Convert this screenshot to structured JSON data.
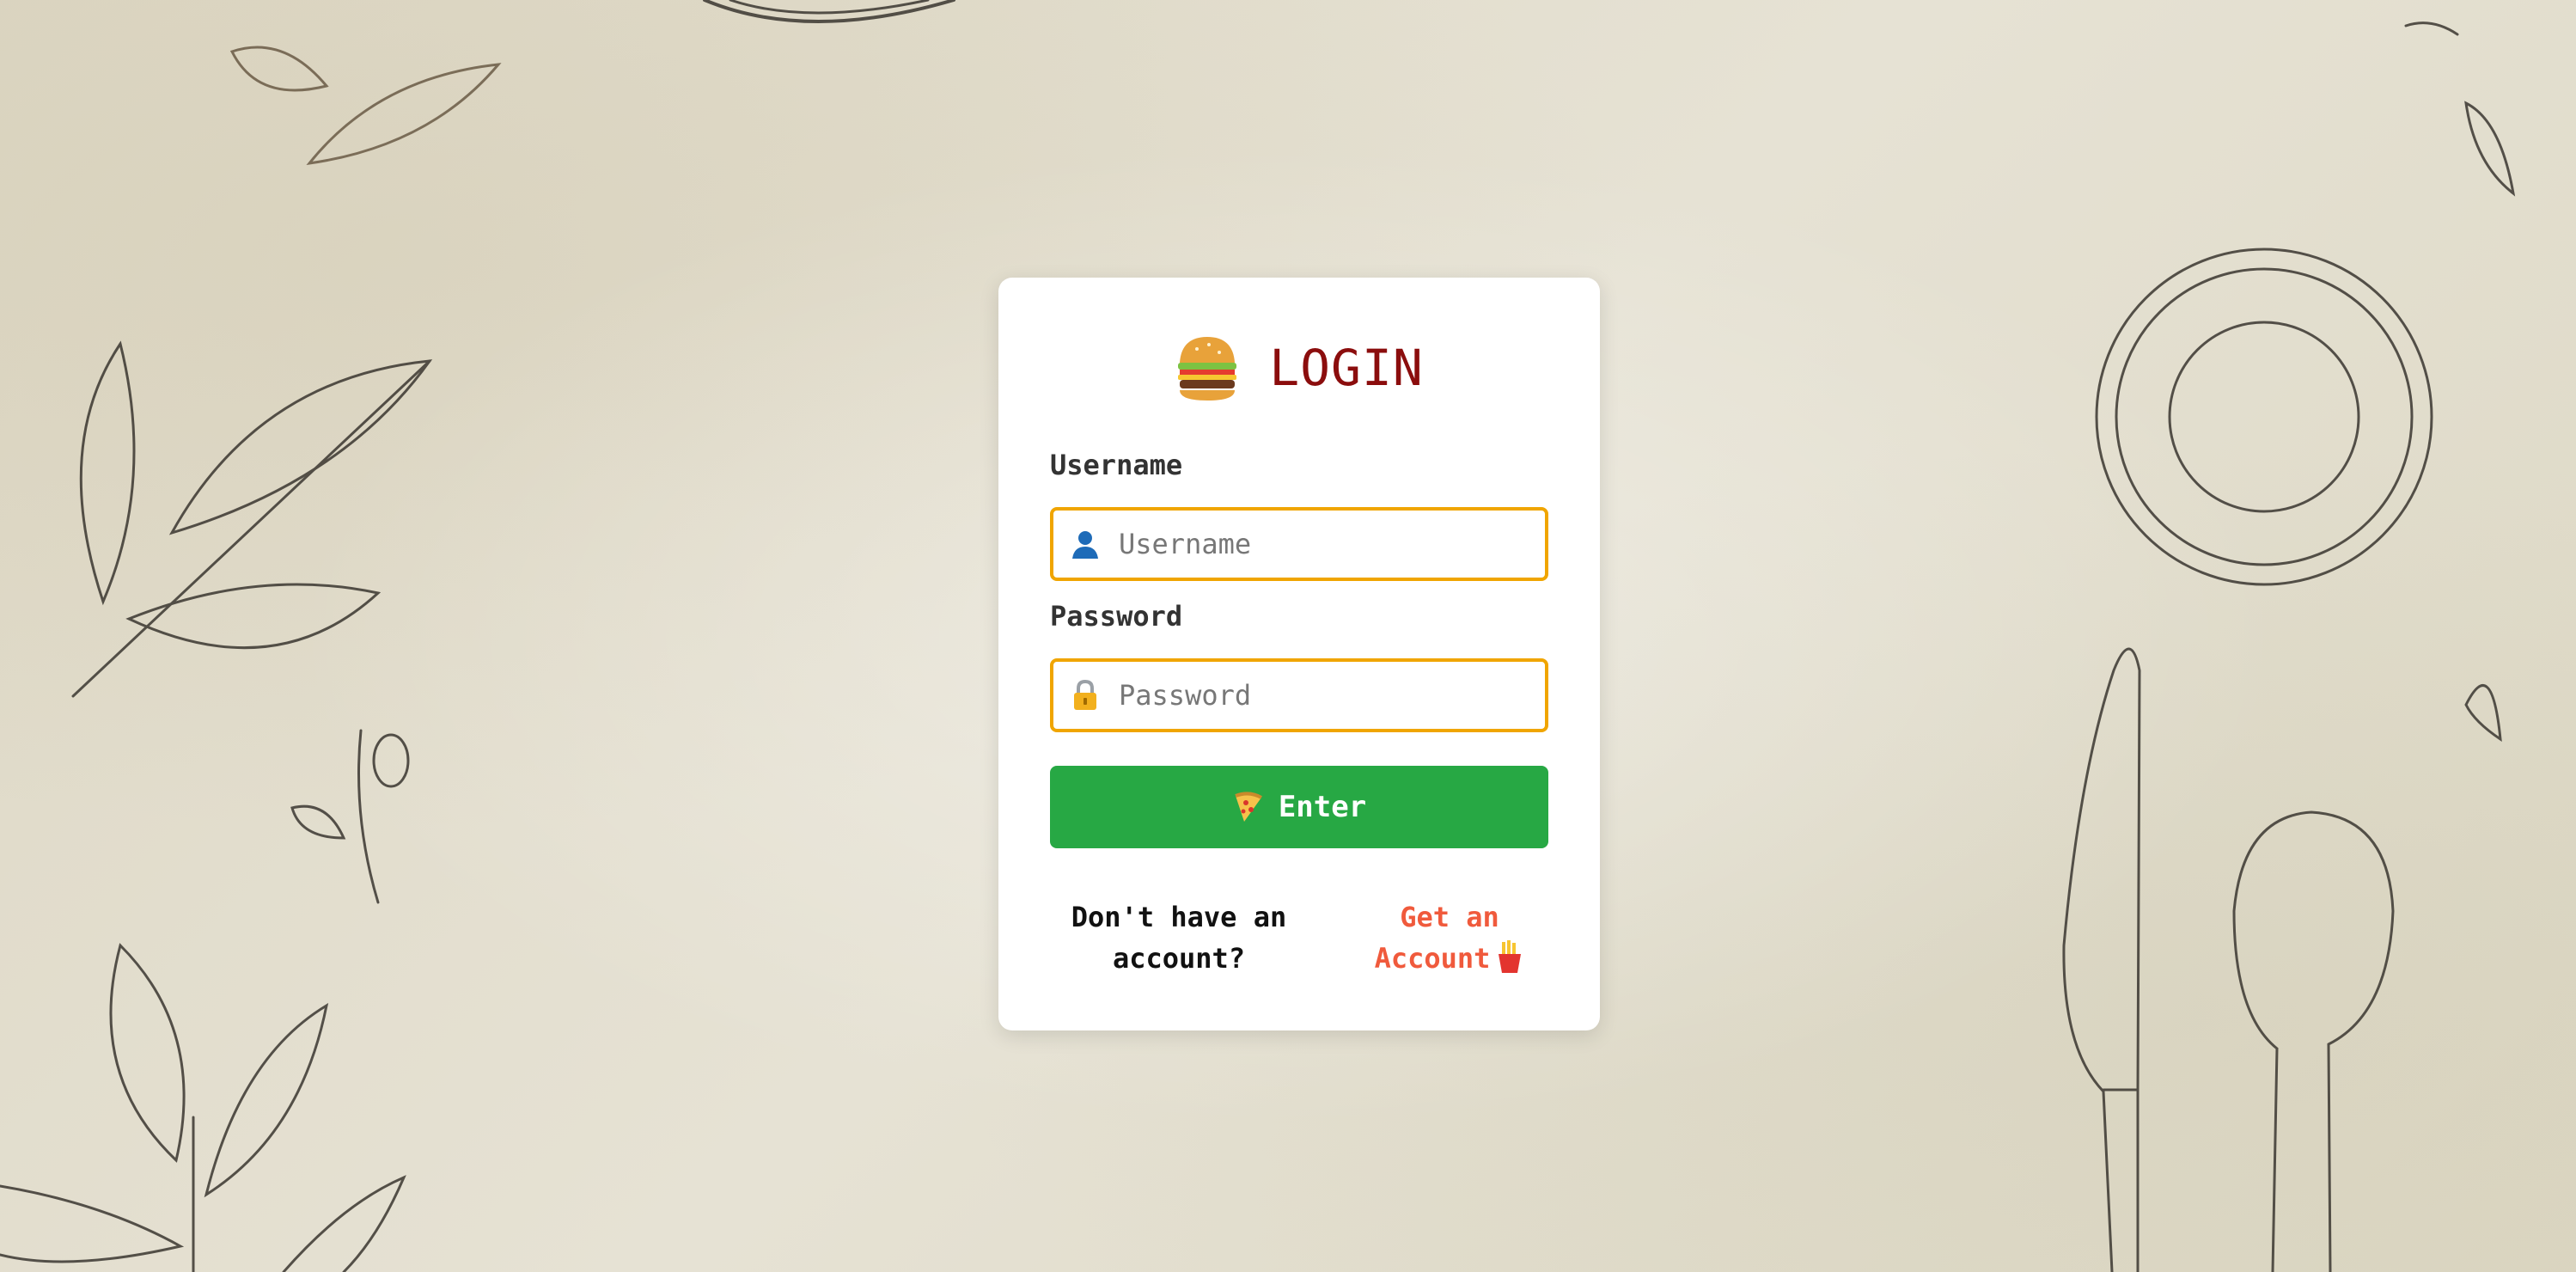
{
  "login": {
    "title": "LOGIN",
    "title_icon": "burger-icon",
    "username_label": "Username",
    "username_placeholder": "Username",
    "username_value": "",
    "username_icon": "user-icon",
    "password_label": "Password",
    "password_placeholder": "Password",
    "password_value": "",
    "password_icon": "lock-icon",
    "enter_label": "Enter",
    "enter_icon": "pizza-icon",
    "no_account_text": "Don't have an account?",
    "get_account_link": "Get an Account",
    "get_account_icon": "fries-icon"
  },
  "colors": {
    "title": "#8b0d0d",
    "field_border": "#f0a500",
    "enter_button": "#27a844",
    "link": "#f05a3c"
  }
}
